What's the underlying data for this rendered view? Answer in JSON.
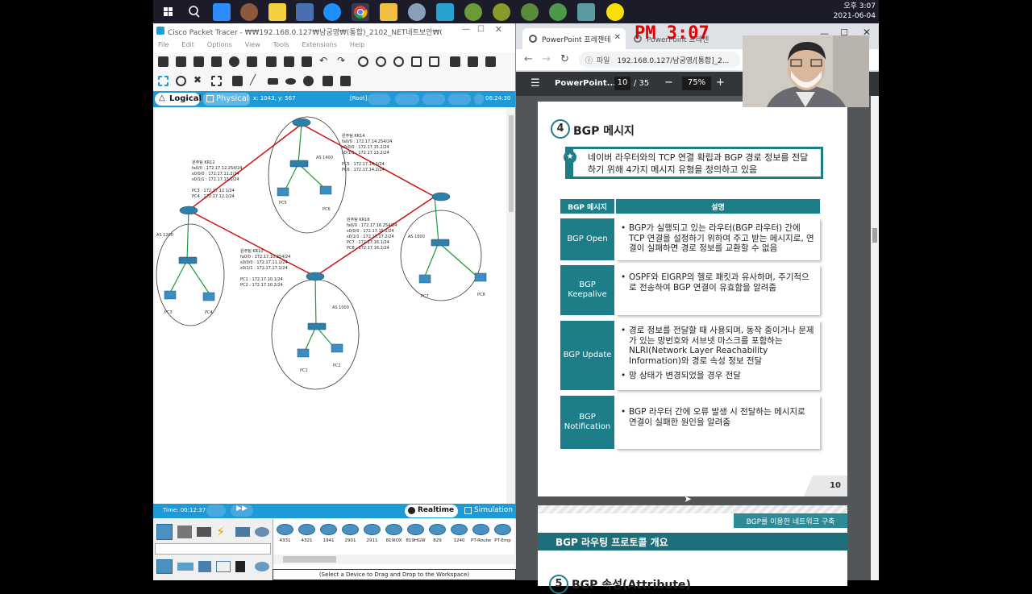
{
  "taskbar": {
    "icons": [
      "start-icon",
      "search-icon",
      "zoom-icon",
      "app-icon",
      "notepad-icon",
      "control-icon",
      "ie-icon",
      "chrome-icon",
      "folder-icon",
      "app2-icon",
      "app3-icon",
      "app4-icon",
      "app5-icon",
      "app6-icon",
      "app7-icon",
      "kakao-icon"
    ],
    "clock_time": "오후 3:07",
    "clock_date": "2021-06-04"
  },
  "packet_tracer": {
    "title": "Cisco Packet Tracer - ₩₩192.168.0.127₩남궁영₩(통합)_2102_NET네트보안₩01_학과...",
    "menu": [
      "File",
      "Edit",
      "Options",
      "View",
      "Tools",
      "Extensions",
      "Help"
    ],
    "tab_logical": "Logical",
    "tab_physical": "Physical",
    "coords": "x: 1043, y: 567",
    "root_label": "[Root]",
    "clock": "06:24:30",
    "time_label": "Time: 00:12:37",
    "realtime": "Realtime",
    "simulation": "Simulation",
    "status": "(Select a Device to Drag and Drop to the Workspace)",
    "devices": [
      "4331",
      "4321",
      "1941",
      "2901",
      "2911",
      "819IOX",
      "819HGW",
      "829",
      "1240",
      "PT-Router",
      "PT-Emp"
    ]
  },
  "topology": {
    "as_labels": [
      "AS 1400",
      "AS 1200",
      "AS 1600",
      "AS 1000"
    ],
    "kr14": [
      "원주팀 KR14",
      "fa0/0   : 172.17.14.254/24",
      "s0/0/0 : 172.17.15.2/24",
      "s0/1/1  : 172.17.13.2/24",
      "",
      "PC5  : 172.17.14.1/24",
      "PC6  : 172.17.14.2/24"
    ],
    "kr12": [
      "원주팀 KR12",
      "fa0/0  : 172.17.12.254/24",
      "s0/0/0 : 172.17.11.2/24",
      "s0/1/1  : 172.17.13.1/24",
      "",
      "PC3  : 172.17.12.1/24",
      "PC4  : 172.17.12.2/24"
    ],
    "kr16": [
      "원주팀 KR16",
      "fa0/0   : 172.17.16.254/24",
      "s0/0/0 : 172.17.15.1/24",
      "s0/1/1  : 172.17.17.2/24",
      "PC7  : 172.17.16.1/24",
      "PC8  : 172.17.16.2/24"
    ],
    "kr10": [
      "원주팀 KR10",
      "fa0/0  : 172.17.10.254/24",
      "s0/0/0 : 172.17.11.1/24",
      "s0/1/1  : 172.17.17.1/24",
      "",
      "PC1  : 172.17.10.1/24",
      "PC2  : 172.17.10.2/24"
    ],
    "pcs": [
      "PC5",
      "PC6",
      "PC3",
      "PC4",
      "PC7",
      "PC8",
      "PC1",
      "PC2"
    ]
  },
  "chrome": {
    "tab1": "PowerPoint 프레젠테",
    "tab2": "PowerPoint 프레젠",
    "url_prefix": "파일",
    "url": "192.168.0.127/남궁영/[통합]_2..."
  },
  "red_clock": "PM 3:07",
  "pdf": {
    "doc_title": "PowerPoint...",
    "page": "10",
    "total": "/ 35",
    "zoom": "75%"
  },
  "slide": {
    "num": "4",
    "heading": "BGP 메시지",
    "intro": "네이버 라우터와의 TCP 연결 확립과 BGP 경로 정보를 전달하기 위해 4가지 메시지 유형을 정의하고 있음",
    "col1": "BGP 메시지",
    "col2": "설명",
    "rows": [
      {
        "label": "BGP Open",
        "items": [
          "BGP가 실행되고 있는 라우터(BGP 라우터) 간에 TCP 연결을 설정하기 위하여 주고 받는 메시지로, 연결이 실패하면 경로 정보를 교환할 수 없음"
        ]
      },
      {
        "label": "BGP Keepalive",
        "items": [
          "OSPF와 EIGRP의 헬로 패킷과 유사하며, 주기적으로 전송하여 BGP 연결이 유효함을 알려줌"
        ]
      },
      {
        "label": "BGP Update",
        "items": [
          "경로 정보를 전달할 때 사용되며, 동작 중이거나 문제가 있는 망번호와 서브넷 마스크를 포함하는 NLRI(Network Layer Reachability Information)와 경로 속성 정보 전달",
          "망 상태가 변경되었을 경우 전달"
        ]
      },
      {
        "label": "BGP Notification",
        "items": [
          "BGP 라우터 간에 오류 발생 시 전달하는 메시지로 연결이 실패한 원인을 알려줌"
        ]
      }
    ],
    "page_num": "10",
    "next_tag": "BGP를 이용한 네트워크 구축",
    "next_title": "BGP 라우팅 프로토콜 개요",
    "next_heading": "BGP 속성(Attribute)",
    "next_num": "5"
  }
}
